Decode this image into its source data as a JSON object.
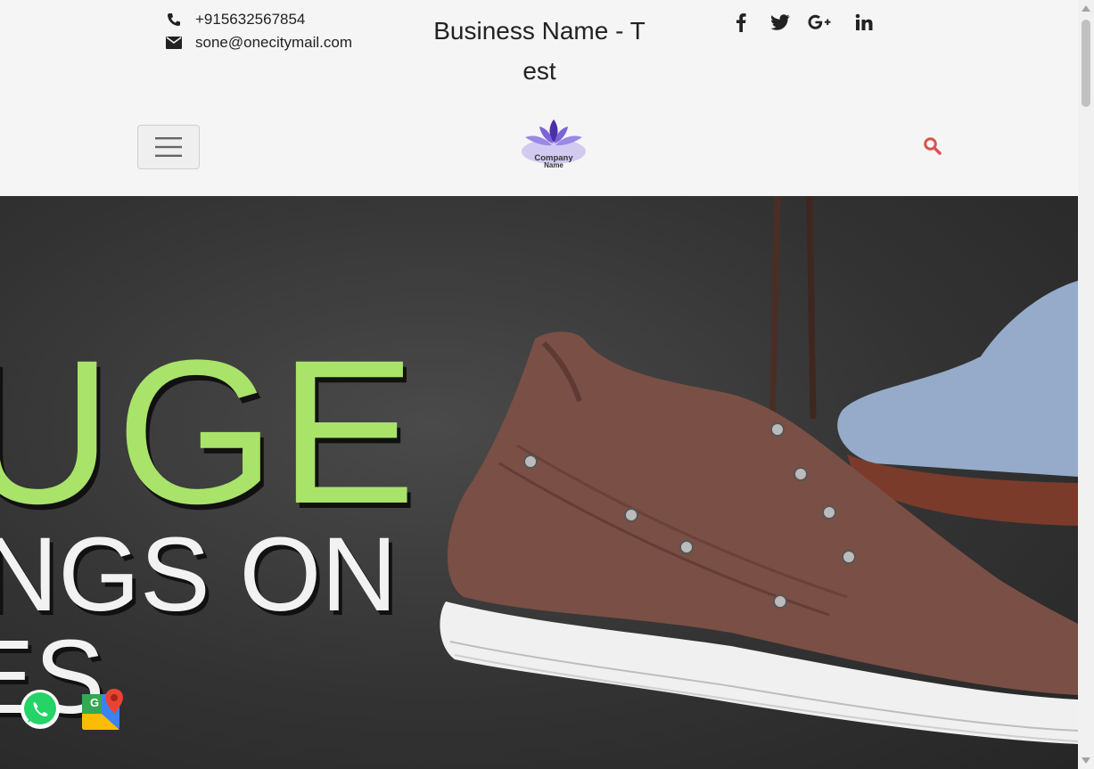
{
  "contact": {
    "phone": "+915632567854",
    "email": "sone@onecitymail.com"
  },
  "business_name": {
    "line1": "Business Name - T",
    "line2": "est"
  },
  "social": [
    "facebook-icon",
    "twitter-icon",
    "google-plus-icon",
    "linkedin-icon"
  ],
  "logo": {
    "line1": "Company",
    "line2": "Name"
  },
  "hero": {
    "line1": "UGE",
    "line2": "NGS ON",
    "line3": "ES"
  },
  "floating": [
    "whatsapp-icon",
    "google-maps-icon"
  ],
  "colors": {
    "accent": "#d9534f",
    "hero_green": "#a9e36a",
    "logo_purple": "#6a4fc3"
  }
}
